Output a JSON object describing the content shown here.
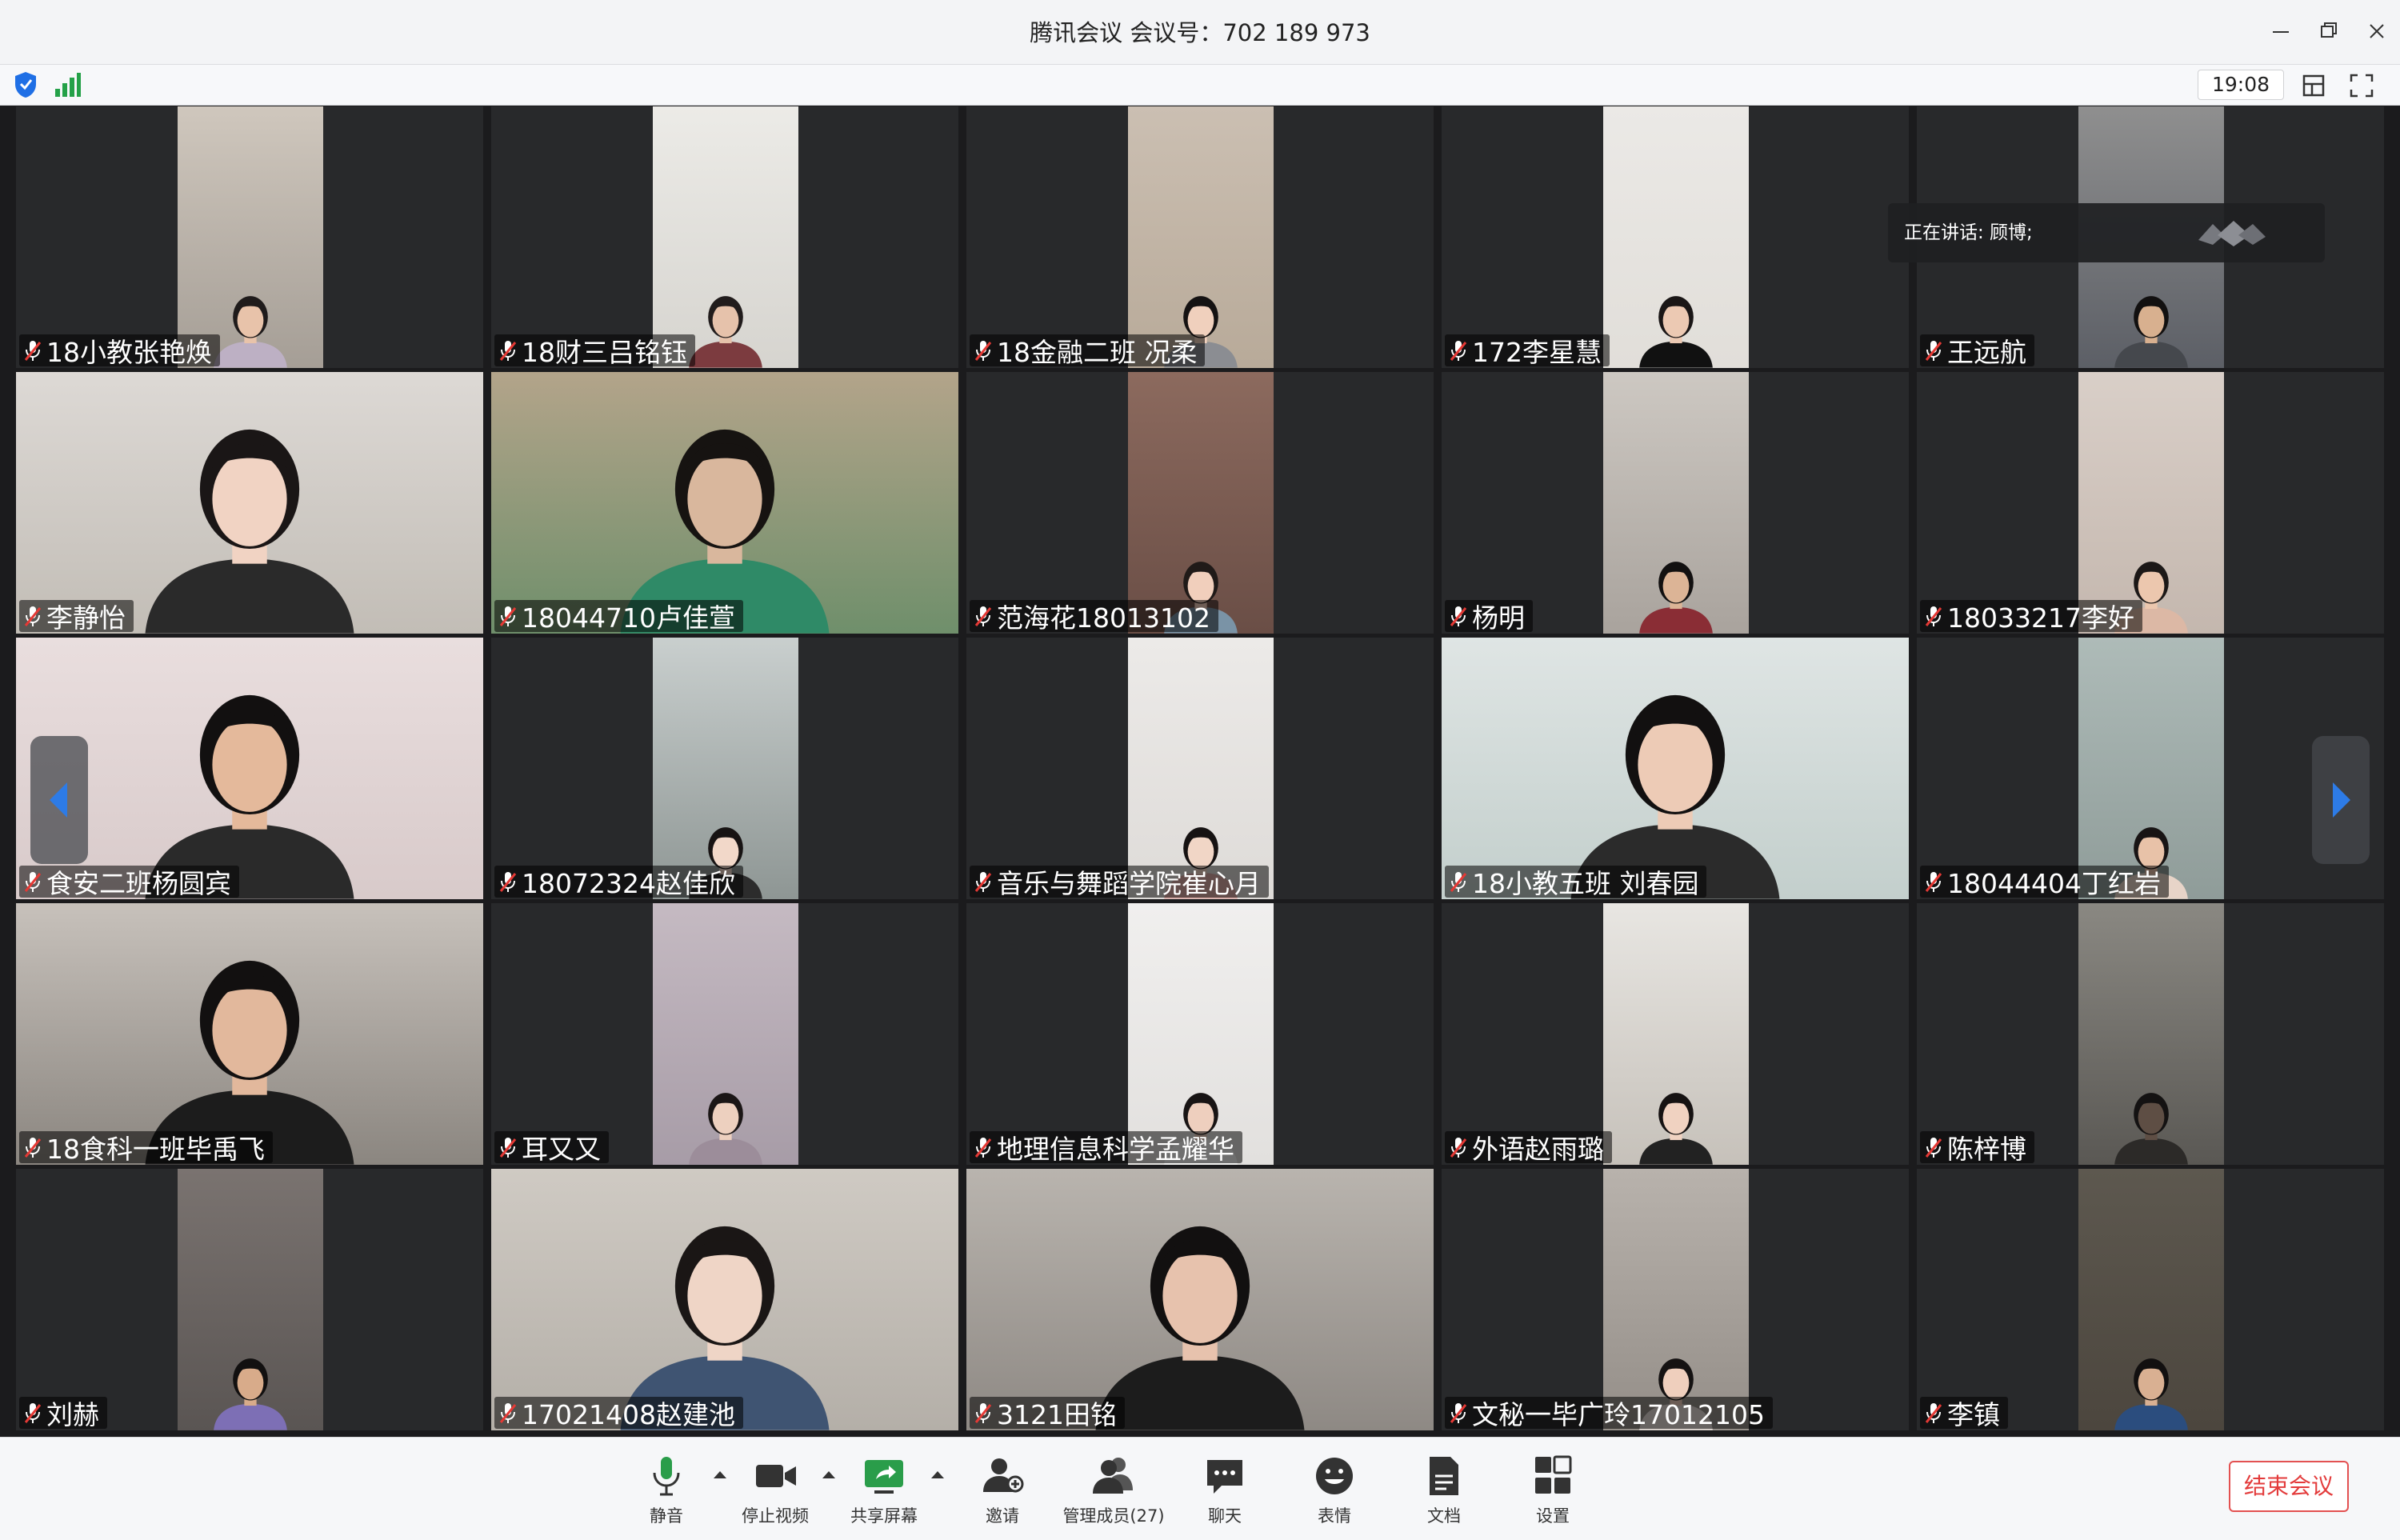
{
  "window": {
    "title": "腾讯会议 会议号：702 189 973",
    "minimize_icon": "minimize-icon",
    "restore_icon": "restore-icon",
    "close_icon": "close-icon"
  },
  "infobar": {
    "time": "19:08",
    "security_icon": "shield-icon",
    "network_icon": "signal-icon",
    "layout_icon": "layout-icon",
    "fullscreen_icon": "fullscreen-icon"
  },
  "speaking": {
    "text": "正在讲话: 顾博;"
  },
  "participants": [
    {
      "name": "18小教张艳焕",
      "bg1": "#cfc7bd",
      "bg2": "#a59e96",
      "skin": "#e8c3aa",
      "shirt": "#bdb0c4",
      "hair": "#1f1b1b"
    },
    {
      "name": "18财三吕铭钰",
      "bg1": "#ecebe7",
      "bg2": "#d6d4cf",
      "skin": "#e6c2ab",
      "shirt": "#7c3b3f",
      "hair": "#211c1c"
    },
    {
      "name": "18金融二班  况柔",
      "bg1": "#cbbfb2",
      "bg2": "#b8aa99",
      "skin": "#f0d0bd",
      "shirt": "#8b8d92",
      "hair": "#151212"
    },
    {
      "name": "172李星慧",
      "bg1": "#ebe9e6",
      "bg2": "#e1ded9",
      "skin": "#ecc9b3",
      "shirt": "#111",
      "hair": "#1a1616"
    },
    {
      "name": "王远航",
      "bg1": "#8f8f8f",
      "bg2": "#5c5f66",
      "skin": "#d8b08f",
      "shirt": "#45484d",
      "hair": "#121010"
    },
    {
      "name": "李静怡",
      "bg1": "#ddd9d5",
      "bg2": "#c2bdb6",
      "skin": "#f1d3c3",
      "shirt": "#2a2a2a",
      "hair": "#1a1616",
      "full": true
    },
    {
      "name": "18044710卢佳萱",
      "bg1": "#b3a48a",
      "bg2": "#6f8f6b",
      "skin": "#d9b79d",
      "shirt": "#2f8a67",
      "hair": "#161311",
      "full": true
    },
    {
      "name": "范海花18013102",
      "bg1": "#8c6a5e",
      "bg2": "#6a4e46",
      "skin": "#f1cfbc",
      "shirt": "#7a93a6",
      "hair": "#201a18"
    },
    {
      "name": "杨明",
      "bg1": "#cdc8c2",
      "bg2": "#a9a39d",
      "skin": "#dcb496",
      "shirt": "#8a2d35",
      "hair": "#121010"
    },
    {
      "name": "18033217李好",
      "bg1": "#d9cfc8",
      "bg2": "#c4b7ae",
      "skin": "#ecc7ae",
      "shirt": "#dcb8a5",
      "hair": "#1c1817"
    },
    {
      "name": "食安二班杨圆宾",
      "bg1": "#e9dede",
      "bg2": "#d8caca",
      "skin": "#e4b99b",
      "shirt": "#2a2a2a",
      "hair": "#121010",
      "full": true
    },
    {
      "name": "18072324赵佳欣",
      "bg1": "#c9cfce",
      "bg2": "#8e9694",
      "skin": "#f2d8c9",
      "shirt": "#2c2c2c",
      "hair": "#171313"
    },
    {
      "name": "音乐与舞蹈学院崔心月",
      "bg1": "#eceae8",
      "bg2": "#dedbd8",
      "skin": "#f1d6c6",
      "shirt": "#d9a9a4",
      "hair": "#161212"
    },
    {
      "name": "18小教五班  刘春园",
      "bg1": "#dfe5e4",
      "bg2": "#c3cfcc",
      "skin": "#edcbb6",
      "shirt": "#2b2b2b",
      "hair": "#121010",
      "full": true
    },
    {
      "name": "18044404丁红岩",
      "bg1": "#aebbb8",
      "bg2": "#8f9c99",
      "skin": "#e8c2a8",
      "shirt": "#e7d4c8",
      "hair": "#181414"
    },
    {
      "name": "18食科一班毕禹飞",
      "bg1": "#c7c1bb",
      "bg2": "#8b8680",
      "skin": "#e2b89c",
      "shirt": "#1c1c1c",
      "hair": "#121010",
      "full": true
    },
    {
      "name": "耳又又",
      "bg1": "#c5bac2",
      "bg2": "#a79ca7",
      "skin": "#edd0bf",
      "shirt": "#9c8d9a",
      "hair": "#1b1616"
    },
    {
      "name": "地理信息科学孟耀华",
      "bg1": "#f0efee",
      "bg2": "#e2e0de",
      "skin": "#eecfbe",
      "shirt": "#f5f5f5",
      "hair": "#181414"
    },
    {
      "name": "外语赵雨璐",
      "bg1": "#e8e6e2",
      "bg2": "#c6c1ba",
      "skin": "#f0d2c1",
      "shirt": "#222",
      "hair": "#161212"
    },
    {
      "name": "陈梓博",
      "bg1": "#8a8882",
      "bg2": "#5a5854",
      "skin": "#5e4e44",
      "shirt": "#2c2a28",
      "hair": "#141212"
    },
    {
      "name": "刘赫",
      "bg1": "#7a7370",
      "bg2": "#5a5553",
      "skin": "#d8ab8a",
      "shirt": "#7d6fb5",
      "hair": "#121010"
    },
    {
      "name": "17021408赵建池",
      "bg1": "#cfcac3",
      "bg2": "#b4afa8",
      "skin": "#efd5c6",
      "shirt": "#3f5472",
      "hair": "#1a1615",
      "full": true
    },
    {
      "name": "3121田铭",
      "bg1": "#b9b4ae",
      "bg2": "#8e8984",
      "skin": "#e7c2ad",
      "shirt": "#1c1c1c",
      "hair": "#121010",
      "full": true
    },
    {
      "name": "文秘一毕广玲17012105",
      "bg1": "#b8b2ac",
      "bg2": "#948e88",
      "skin": "#efcfbd",
      "shirt": "#e4dcd7",
      "hair": "#151212"
    },
    {
      "name": "李镇",
      "bg1": "#5d584f",
      "bg2": "#4c463e",
      "skin": "#d9b092",
      "shirt": "#2b4d7e",
      "hair": "#121010"
    }
  ],
  "toolbar": {
    "mute_label": "静音",
    "video_label": "停止视频",
    "share_label": "共享屏幕",
    "invite_label": "邀请",
    "members_label": "管理成员(27)",
    "chat_label": "聊天",
    "emoji_label": "表情",
    "docs_label": "文档",
    "settings_label": "设置",
    "end_label": "结束会议",
    "accent_color": "#2a9d4a",
    "end_color": "#e33b3b"
  }
}
